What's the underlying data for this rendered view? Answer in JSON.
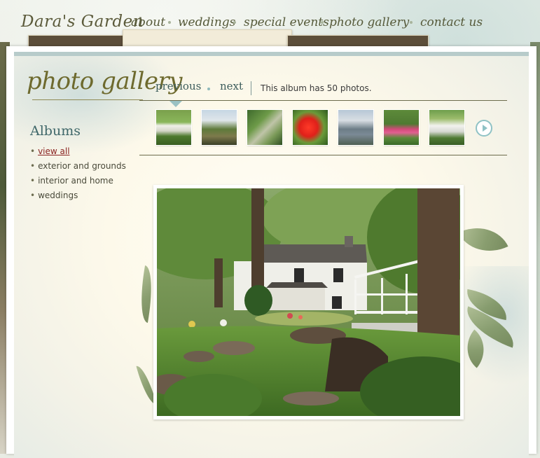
{
  "site": {
    "logo": "Dara's Garden",
    "nav": [
      {
        "label": "about"
      },
      {
        "label": "weddings"
      },
      {
        "label": "special events"
      },
      {
        "label": "photo gallery"
      },
      {
        "label": "contact us"
      }
    ]
  },
  "gallery": {
    "title": "photo gallery",
    "previous_label": "previous",
    "next_label": "next",
    "album_count_text": "This album has 50 photos.",
    "thumbnails": [
      {
        "alt": "house exterior with lawn"
      },
      {
        "alt": "garden with pond"
      },
      {
        "alt": "garden path"
      },
      {
        "alt": "red hibiscus flower"
      },
      {
        "alt": "house with driveway"
      },
      {
        "alt": "flower beds"
      },
      {
        "alt": "white house"
      }
    ],
    "thumb_next_icon": "play-circle-icon"
  },
  "albums": {
    "heading": "Albums",
    "items": [
      {
        "label": "view all",
        "active": true
      },
      {
        "label": "exterior and grounds",
        "active": false
      },
      {
        "label": "interior and home",
        "active": false
      },
      {
        "label": "weddings",
        "active": false
      }
    ]
  },
  "colors": {
    "accent": "#3f6769",
    "logo": "#5b5a3a",
    "active_link": "#8a2422",
    "divider_arrow": "#9ac1c3"
  }
}
